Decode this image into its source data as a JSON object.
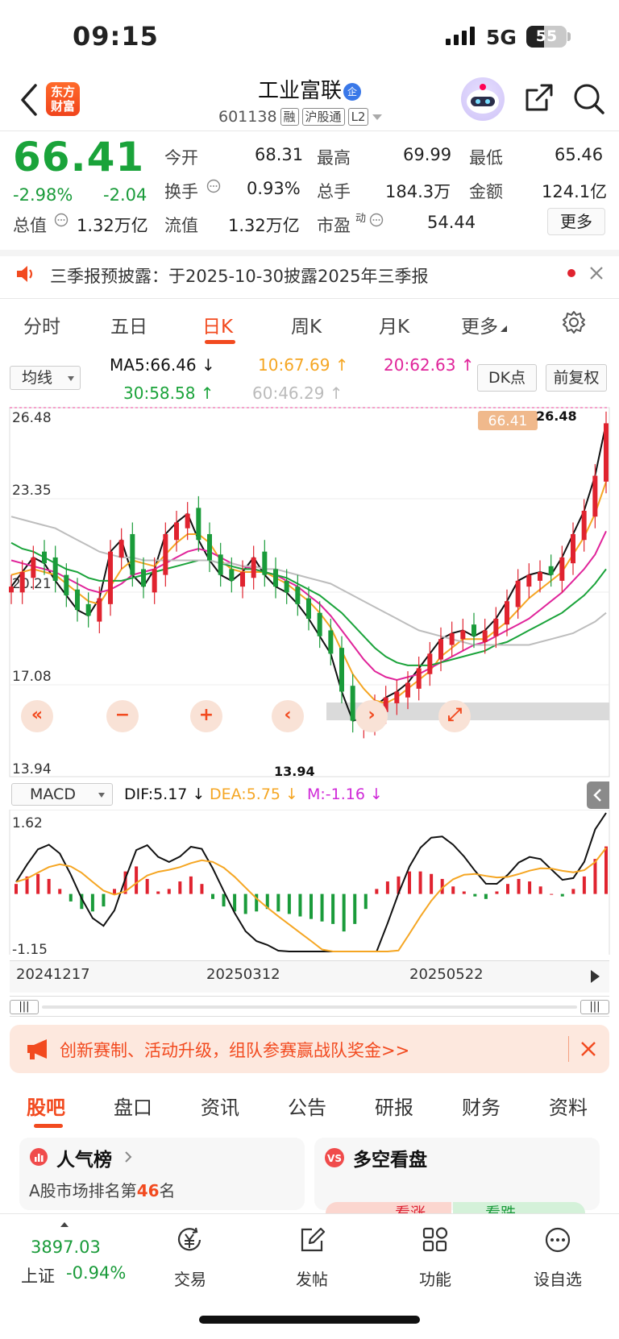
{
  "status_bar": {
    "time": "09:15",
    "network": "5G",
    "battery": "55"
  },
  "header": {
    "app_logo": "东方\n财富",
    "stock_name": "工业富联",
    "badge": "企",
    "code": "601138",
    "tags": [
      "融",
      "沪股通",
      "L2"
    ]
  },
  "quote": {
    "price": "66.41",
    "change_pct": "-2.98%",
    "change": "-2.04",
    "open_label": "今开",
    "open": "68.31",
    "high_label": "最高",
    "high": "69.99",
    "low_label": "最低",
    "low": "65.46",
    "turnover_label": "换手",
    "turnover": "0.93%",
    "volume_label": "总手",
    "volume": "184.3万",
    "amount_label": "金额",
    "amount": "124.1亿",
    "mktcap_label": "总值",
    "mktcap": "1.32万亿",
    "float_label": "流值",
    "float_cap": "1.32万亿",
    "pe_label": "市盈",
    "pe_sup": "动",
    "pe": "54.44",
    "more": "更多"
  },
  "notice": {
    "text": "三季报预披露：于2025-10-30披露2025年三季报"
  },
  "chart_tabs": [
    "分时",
    "五日",
    "日K",
    "周K",
    "月K",
    "更多"
  ],
  "chart_tab_active": 2,
  "indicator": {
    "selector": "均线",
    "ma5": "MA5:66.46",
    "ma10": "10:67.69",
    "ma20": "20:62.63",
    "ma30": "30:58.58",
    "ma60": "60:46.29",
    "dk": "DK点",
    "adjust": "前复权"
  },
  "colors": {
    "up": "#e0232f",
    "down": "#1a9b3a",
    "ma5": "#111111",
    "ma10": "#f5a623",
    "ma20": "#e0249a",
    "ma30": "#1aa33a",
    "ma60": "#bdbdbd",
    "accent": "#f24a1f"
  },
  "chart_data": [
    {
      "type": "candlestick",
      "axis_ticks": [
        "26.48",
        "23.35",
        "20.21",
        "17.08",
        "13.94"
      ],
      "ylim": [
        13.94,
        26.48
      ],
      "max_label": "26.48",
      "min_label": "13.94",
      "last_price_tag": "66.41",
      "ma_series": [
        {
          "name": "MA5",
          "values": [
            20.4,
            20.9,
            21.4,
            21.2,
            20.6,
            20.1,
            19.6,
            19.4,
            20.0,
            21.6,
            22.0,
            20.8,
            20.4,
            21.0,
            22.2,
            22.6,
            22.9,
            22.0,
            21.3,
            20.8,
            20.6,
            20.9,
            21.4,
            20.8,
            20.4,
            20.2,
            19.8,
            19.3,
            18.7,
            18.1,
            16.8,
            15.8,
            15.9,
            16.3,
            16.6,
            16.8,
            17.1,
            17.6,
            18.1,
            18.6,
            18.8,
            18.9,
            18.7,
            18.9,
            19.3,
            19.9,
            20.6,
            20.8,
            20.9,
            20.8,
            21.4,
            22.2,
            23.0,
            24.2,
            26.0
          ]
        },
        {
          "name": "MA10",
          "values": [
            20.8,
            20.9,
            21.0,
            20.9,
            20.8,
            20.5,
            20.2,
            19.9,
            19.8,
            20.4,
            21.0,
            21.3,
            21.2,
            21.1,
            21.5,
            21.9,
            22.2,
            22.2,
            21.9,
            21.3,
            21.0,
            20.9,
            20.9,
            20.9,
            20.7,
            20.5,
            20.2,
            19.9,
            19.5,
            19.0,
            18.2,
            17.4,
            16.9,
            16.5,
            16.4,
            16.6,
            16.9,
            17.2,
            17.5,
            18.0,
            18.3,
            18.6,
            18.6,
            18.6,
            18.9,
            19.2,
            19.6,
            20.0,
            20.3,
            20.6,
            20.9,
            21.5,
            22.1,
            22.9,
            24.0
          ]
        },
        {
          "name": "MA20",
          "values": [
            21.3,
            21.2,
            21.1,
            21.0,
            20.9,
            20.7,
            20.5,
            20.3,
            20.2,
            20.3,
            20.5,
            20.8,
            20.9,
            21.0,
            21.2,
            21.4,
            21.6,
            21.7,
            21.6,
            21.4,
            21.2,
            21.1,
            21.0,
            20.9,
            20.8,
            20.6,
            20.4,
            20.1,
            19.8,
            19.4,
            18.9,
            18.4,
            17.9,
            17.5,
            17.3,
            17.2,
            17.3,
            17.4,
            17.6,
            17.8,
            18.0,
            18.2,
            18.4,
            18.5,
            18.7,
            18.9,
            19.1,
            19.3,
            19.6,
            19.9,
            20.2,
            20.6,
            21.0,
            21.5,
            22.3
          ]
        },
        {
          "name": "MA30",
          "values": [
            21.9,
            21.7,
            21.6,
            21.4,
            21.2,
            21.0,
            20.9,
            20.7,
            20.6,
            20.6,
            20.6,
            20.7,
            20.8,
            20.9,
            21.0,
            21.1,
            21.2,
            21.3,
            21.3,
            21.2,
            21.1,
            21.0,
            21.0,
            20.9,
            20.8,
            20.7,
            20.5,
            20.3,
            20.1,
            19.8,
            19.5,
            19.1,
            18.7,
            18.3,
            18.0,
            17.8,
            17.7,
            17.7,
            17.7,
            17.8,
            17.9,
            18.0,
            18.1,
            18.2,
            18.4,
            18.5,
            18.7,
            18.9,
            19.1,
            19.3,
            19.5,
            19.8,
            20.1,
            20.5,
            21.0
          ]
        },
        {
          "name": "MA60",
          "values": [
            22.8,
            22.7,
            22.6,
            22.5,
            22.4,
            22.2,
            22.0,
            21.8,
            21.6,
            21.5,
            21.4,
            21.4,
            21.3,
            21.3,
            21.3,
            21.3,
            21.3,
            21.3,
            21.3,
            21.2,
            21.2,
            21.1,
            21.1,
            21.0,
            21.0,
            20.9,
            20.8,
            20.7,
            20.6,
            20.5,
            20.3,
            20.1,
            19.9,
            19.7,
            19.5,
            19.3,
            19.1,
            18.9,
            18.8,
            18.7,
            18.6,
            18.5,
            18.4,
            18.4,
            18.4,
            18.4,
            18.4,
            18.4,
            18.5,
            18.6,
            18.7,
            18.8,
            19.0,
            19.2,
            19.5
          ]
        }
      ]
    },
    {
      "type": "bar",
      "name": "MACD",
      "dif": "DIF:5.17",
      "dea": "DEA:5.75",
      "m": "M:-1.16",
      "axis_ticks": [
        "1.62",
        "-1.15"
      ],
      "ylim": [
        -1.15,
        1.62
      ],
      "x": [
        "20241217",
        "20250312",
        "20250522"
      ],
      "values": [
        0.2,
        0.35,
        0.4,
        0.3,
        0.1,
        -0.15,
        -0.3,
        -0.35,
        -0.25,
        0.1,
        0.45,
        0.55,
        0.3,
        0.05,
        0.1,
        0.25,
        0.35,
        0.2,
        -0.1,
        -0.25,
        -0.35,
        -0.4,
        -0.35,
        -0.3,
        -0.35,
        -0.4,
        -0.45,
        -0.5,
        -0.55,
        -0.6,
        -0.75,
        -0.6,
        -0.3,
        0.1,
        0.25,
        0.35,
        0.45,
        0.45,
        0.4,
        0.3,
        0.15,
        0.05,
        -0.05,
        -0.1,
        0.05,
        0.2,
        0.3,
        0.25,
        0.15,
        0.0,
        -0.05,
        0.1,
        0.35,
        0.7,
        0.95
      ]
    }
  ],
  "chart_controls": [
    "«",
    "−",
    "+",
    "‹",
    "›",
    "⤢"
  ],
  "banner": {
    "text": "创新赛制、活动升级，组队参赛赢战队奖金>>"
  },
  "bottom_tabs": [
    "股吧",
    "盘口",
    "资讯",
    "公告",
    "研报",
    "财务",
    "资料"
  ],
  "cards": [
    {
      "title": "人气榜",
      "sub_prefix": "A股市场排名第",
      "rank": "46",
      "sub_suffix": "名"
    },
    {
      "title": "多空看盘",
      "up": "看涨",
      "down": "看跌"
    }
  ],
  "bottom_nav": {
    "index_value": "3897.03",
    "index_name": "上证",
    "index_change": "-0.94%",
    "items": [
      "交易",
      "发帖",
      "功能",
      "设自选"
    ]
  }
}
